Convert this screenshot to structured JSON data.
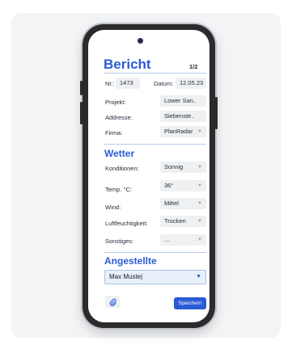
{
  "report": {
    "title": "Bericht",
    "page_indicator": "1/2",
    "nr_label": "Nr.:",
    "nr_value": "1473",
    "datum_label": "Datum:",
    "datum_value": "12.05.23",
    "projekt_label": "Projekt:",
    "projekt_value": "Lower San..",
    "addresse_label": "Addresse:",
    "addresse_value": "Siebenste..",
    "firma_label": "Firma:",
    "firma_value": "PlanRadar"
  },
  "weather": {
    "title": "Wetter",
    "rows": [
      {
        "label": "Konditionen:",
        "value": "Sonnig"
      },
      {
        "label": "Temp. °C:",
        "value": "36°"
      },
      {
        "label": "Wind:",
        "value": "Mittel"
      },
      {
        "label": "Luftfeuchtigkeit:",
        "value": "Trocken"
      },
      {
        "label": "Sonstiges:",
        "value": "..."
      }
    ]
  },
  "employees": {
    "title": "Angestellte",
    "input_value": "Max Muste"
  },
  "footer": {
    "save_label": "Speichern"
  },
  "icons": {
    "attach": "paperclip-icon",
    "dropdown": "chevron-down-icon"
  },
  "colors": {
    "accent": "#2a5bd7",
    "field_bg": "#eef0f2"
  }
}
